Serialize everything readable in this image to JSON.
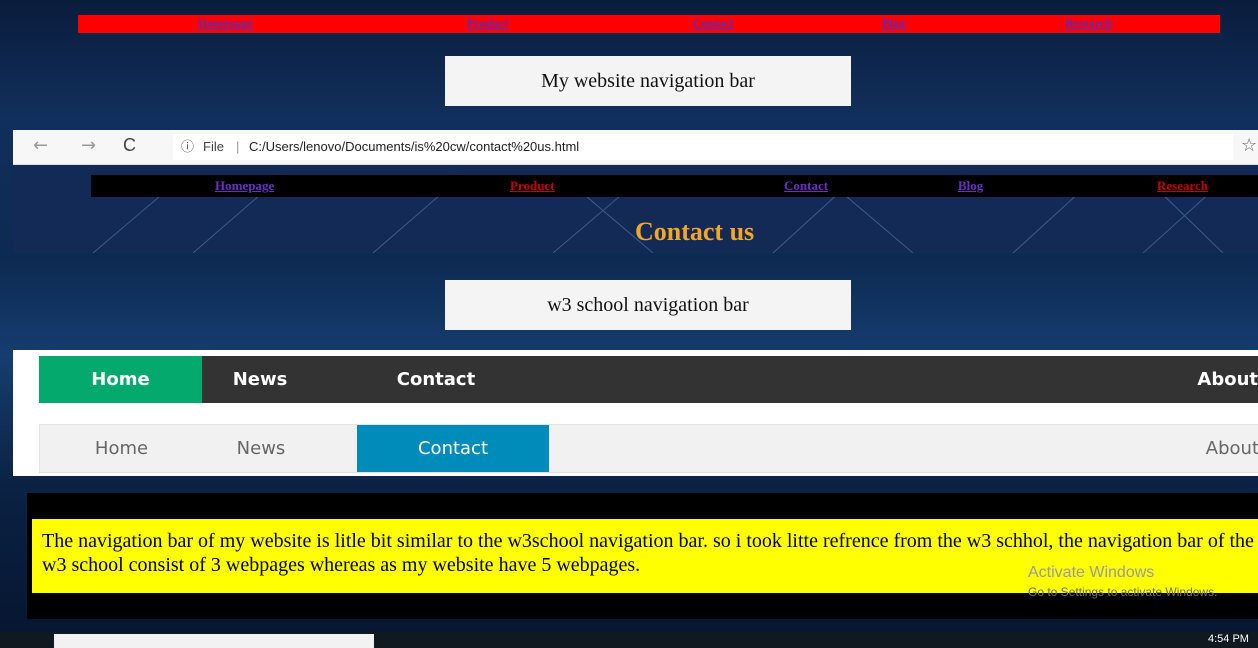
{
  "top_nav": {
    "items": [
      "Homepage",
      "Product",
      "Contact",
      "Blog",
      "Research"
    ],
    "background": "#ff0000",
    "link_color": "#5a2ab8"
  },
  "captions": {
    "my_website": "My website navigation bar",
    "w3school": "w3 school navigation bar"
  },
  "browser": {
    "back_icon": "←",
    "forward_icon": "→",
    "reload_icon": "C",
    "info_icon": "ⓘ",
    "file_label": "File",
    "separator": "|",
    "url": "C:/Users/lenovo/Documents/is%20cw/contact%20us.html",
    "bookmark_icon": "☆"
  },
  "page": {
    "nav_items": [
      "Homepage",
      "Product",
      "Contact",
      "Blog",
      "Research"
    ],
    "nav_colors": [
      "#6a2fc0",
      "#c00000",
      "#6a2fc0",
      "#6a2fc0",
      "#c00000"
    ],
    "title": "Contact us",
    "title_color": "#f5a623"
  },
  "w3_dark_bar": {
    "items": [
      "Home",
      "News",
      "Contact",
      "About"
    ],
    "active_index": 0,
    "active_color": "#04aa6d"
  },
  "w3_light_bar": {
    "items": [
      "Home",
      "News",
      "Contact",
      "About"
    ],
    "active_index": 2,
    "active_color": "#008cba"
  },
  "note": {
    "text": "The navigation bar of my website is litle bit similar to the w3school navigation bar. so i took litte refrence from the w3 schhol, the navigation bar of the w3 school consist of 3 webpages whereas as my website have 5 webpages."
  },
  "watermark": {
    "title": "Activate Windows",
    "subtitle": "Go to Settings to activate Windows."
  },
  "taskbar": {
    "time": "4:54 PM"
  }
}
